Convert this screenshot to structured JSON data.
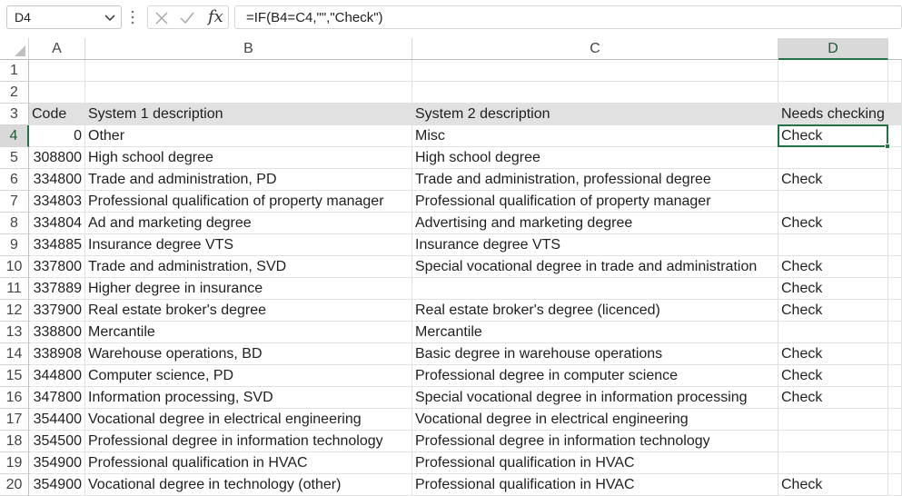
{
  "formula_bar": {
    "name_box": "D4",
    "formula": "=IF(B4=C4,\"\",\"Check\")",
    "fx_label": "fx"
  },
  "columns": [
    "A",
    "B",
    "C",
    "D"
  ],
  "row_numbers": [
    "1",
    "2",
    "3",
    "4",
    "5",
    "6",
    "7",
    "8",
    "9",
    "10",
    "11",
    "12",
    "13",
    "14",
    "15",
    "16",
    "17",
    "18",
    "19",
    "20"
  ],
  "header_row": {
    "row": 3,
    "cells": [
      "Code",
      "System 1 description",
      "System 2 description",
      "Needs checking"
    ]
  },
  "rows": [
    {
      "code": "0",
      "sys1": "Other",
      "sys2": "Misc",
      "check": "Check"
    },
    {
      "code": "308800",
      "sys1": "High school degree",
      "sys2": "High school degree",
      "check": ""
    },
    {
      "code": "334800",
      "sys1": "Trade and administration, PD",
      "sys2": "Trade and administration, professional degree",
      "check": "Check"
    },
    {
      "code": "334803",
      "sys1": "Professional qualification of property manager",
      "sys2": "Professional qualification of property manager",
      "check": ""
    },
    {
      "code": "334804",
      "sys1": "Ad and marketing degree",
      "sys2": "Advertising and marketing degree",
      "check": "Check"
    },
    {
      "code": "334885",
      "sys1": "Insurance degree VTS",
      "sys2": "Insurance degree VTS",
      "check": ""
    },
    {
      "code": "337800",
      "sys1": "Trade and administration, SVD",
      "sys2": "Special vocational degree in trade and administration",
      "check": "Check"
    },
    {
      "code": "337889",
      "sys1": "Higher degree in insurance",
      "sys2": "",
      "check": "Check"
    },
    {
      "code": "337900",
      "sys1": "Real estate broker's degree",
      "sys2": "Real estate broker's degree (licenced)",
      "check": "Check"
    },
    {
      "code": "338800",
      "sys1": "Mercantile",
      "sys2": "Mercantile",
      "check": ""
    },
    {
      "code": "338908",
      "sys1": "Warehouse operations, BD",
      "sys2": "Basic degree in warehouse operations",
      "check": "Check"
    },
    {
      "code": "344800",
      "sys1": "Computer science, PD",
      "sys2": "Professional degree in computer science",
      "check": "Check"
    },
    {
      "code": "347800",
      "sys1": "Information processing, SVD",
      "sys2": "Special vocational degree in information processing",
      "check": "Check"
    },
    {
      "code": "354400",
      "sys1": "Vocational degree in electrical engineering",
      "sys2": "Vocational degree in electrical engineering",
      "check": ""
    },
    {
      "code": "354500",
      "sys1": "Professional degree in information technology",
      "sys2": "Professional degree in information technology",
      "check": ""
    },
    {
      "code": "354900",
      "sys1": "Professional qualification in HVAC",
      "sys2": "Professional qualification in HVAC",
      "check": ""
    },
    {
      "code": "354900",
      "sys1": "Vocational degree in technology (other)",
      "sys2": "Professional qualification in HVAC",
      "check": "Check"
    }
  ],
  "selection": {
    "cell": "D4",
    "column": "D",
    "row": "4"
  },
  "colors": {
    "accent": "#217346",
    "header_fill": "#e1e1e1",
    "selected_header": "#d9d9d9"
  }
}
